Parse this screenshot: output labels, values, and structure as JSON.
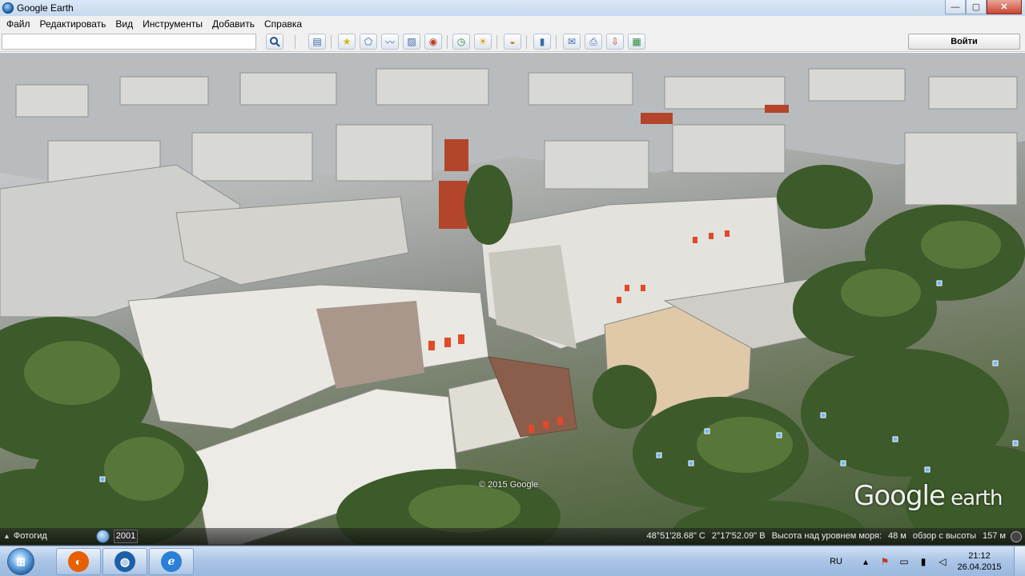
{
  "window": {
    "title": "Google Earth",
    "controls": {
      "minimize": "—",
      "maximize": "▢",
      "close": "✕"
    }
  },
  "menu": {
    "items": [
      "Файл",
      "Редактировать",
      "Вид",
      "Инструменты",
      "Добавить",
      "Справка"
    ]
  },
  "toolbar": {
    "search_value": "",
    "search_icon": "search-icon",
    "buttons": [
      {
        "name": "sidebar-toggle-icon",
        "glyph": "▤"
      },
      {
        "name": "placemark-icon",
        "glyph": "★"
      },
      {
        "name": "polygon-icon",
        "glyph": "⬠"
      },
      {
        "name": "path-icon",
        "glyph": "〰"
      },
      {
        "name": "image-overlay-icon",
        "glyph": "▨"
      },
      {
        "name": "record-tour-icon",
        "glyph": "◉"
      },
      {
        "name": "historical-imagery-icon",
        "glyph": "◷"
      },
      {
        "name": "sunlight-icon",
        "glyph": "☀"
      },
      {
        "name": "planets-icon",
        "glyph": "◒"
      },
      {
        "name": "ruler-icon",
        "glyph": "▮"
      },
      {
        "name": "email-icon",
        "glyph": "✉"
      },
      {
        "name": "print-icon",
        "glyph": "⎙"
      },
      {
        "name": "save-image-icon",
        "glyph": "⇩"
      },
      {
        "name": "maps-icon",
        "glyph": "▦"
      }
    ],
    "signin_label": "Войти"
  },
  "map": {
    "copyright": "© 2015 Google",
    "logo_main": "Google",
    "logo_sub": " earth"
  },
  "statusbar": {
    "tour_guide_label": "Фотогид",
    "year": "2001",
    "latitude": "48°51'28.68\" С",
    "longitude": "2°17'52.09\" В",
    "elevation_label": "Высота над уровнем моря:",
    "elevation_value": "48 м",
    "eye_alt_label": "обзор с высоты",
    "eye_alt_value": "157 м"
  },
  "taskbar": {
    "apps": [
      {
        "name": "firefox-icon",
        "glyph": "◐",
        "color": "#e66000"
      },
      {
        "name": "google-earth-icon",
        "glyph": "◍",
        "color": "#1d5fa8"
      },
      {
        "name": "ie-icon",
        "glyph": "e",
        "color": "#2b7fd8"
      }
    ],
    "language": "RU",
    "time": "21:12",
    "date": "26.04.2015"
  }
}
